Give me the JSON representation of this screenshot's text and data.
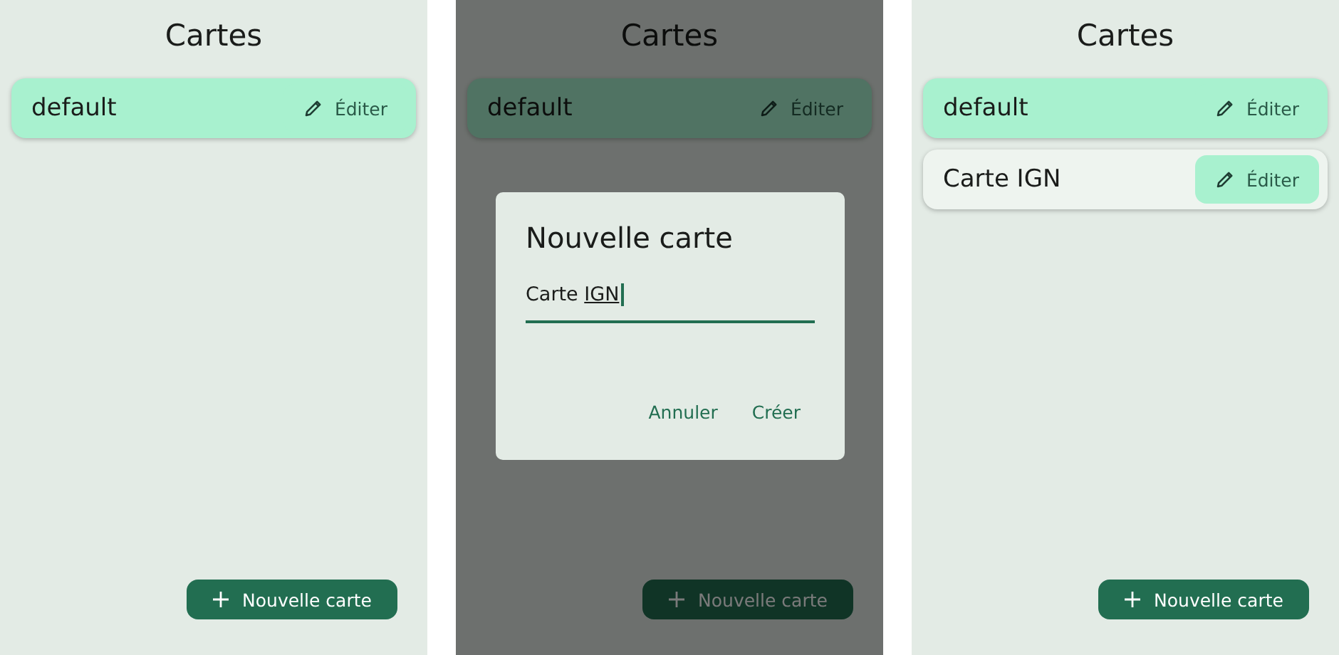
{
  "screens": [
    {
      "title": "Cartes",
      "cards": [
        {
          "name": "default",
          "edit_label": "Éditer",
          "selected": true
        }
      ],
      "fab": {
        "label": "Nouvelle carte"
      }
    },
    {
      "title": "Cartes",
      "cards": [
        {
          "name": "default",
          "edit_label": "Éditer",
          "selected": true
        }
      ],
      "fab": {
        "label": "Nouvelle carte"
      },
      "dialog": {
        "title": "Nouvelle carte",
        "value": "Carte ",
        "composing": "IGN",
        "buttons": [
          "Annuler",
          "Créer"
        ]
      }
    },
    {
      "title": "Cartes",
      "cards": [
        {
          "name": "default",
          "edit_label": "Éditer",
          "selected": true
        },
        {
          "name": "Carte IGN",
          "edit_label": "Éditer",
          "selected": false
        }
      ],
      "fab": {
        "label": "Nouvelle carte"
      }
    }
  ]
}
